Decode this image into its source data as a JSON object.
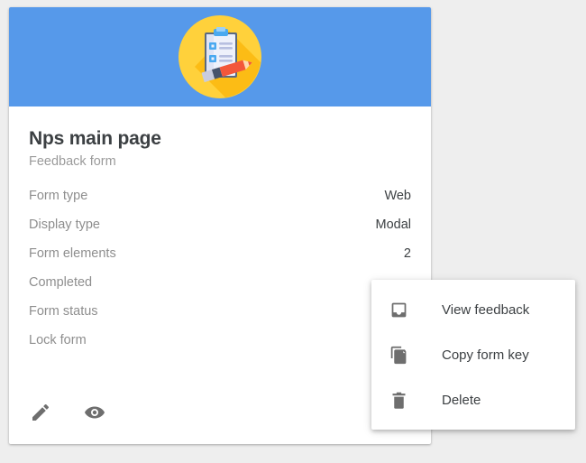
{
  "card": {
    "illustration_icon": "clipboard-checklist-pencil-icon",
    "header_color": "#5699ea",
    "title": "Nps main page",
    "subtitle": "Feedback form",
    "details": [
      {
        "label": "Form type",
        "value": "Web",
        "type": "text"
      },
      {
        "label": "Display type",
        "value": "Modal",
        "type": "text"
      },
      {
        "label": "Form elements",
        "value": "2",
        "type": "text"
      },
      {
        "label": "Completed",
        "value": "",
        "type": "text"
      },
      {
        "label": "Form status",
        "value": "",
        "type": "dot",
        "dot_color": "#cfcfcf"
      },
      {
        "label": "Lock form",
        "value": "",
        "type": "text"
      }
    ],
    "actions": [
      {
        "name": "edit-button",
        "icon": "pencil-icon",
        "label": "Edit"
      },
      {
        "name": "preview-button",
        "icon": "eye-icon",
        "label": "Preview"
      }
    ]
  },
  "context_menu": {
    "items": [
      {
        "icon": "inbox-icon",
        "label": "View feedback"
      },
      {
        "icon": "copy-icon",
        "label": "Copy form key"
      },
      {
        "icon": "trash-icon",
        "label": "Delete"
      }
    ]
  }
}
